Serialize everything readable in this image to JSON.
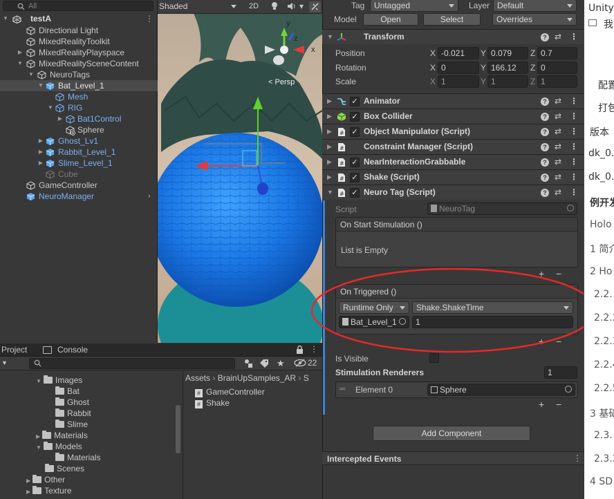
{
  "hierarchy": {
    "search_placeholder": "All",
    "scene_name": "testA",
    "items": [
      {
        "label": "Directional Light"
      },
      {
        "label": "MixedRealityToolkit"
      },
      {
        "label": "MixedRealityPlayspace"
      },
      {
        "label": "MixedRealitySceneContent"
      },
      {
        "label": "NeuroTags"
      },
      {
        "label": "Bat_Level_1"
      },
      {
        "label": "Mesh"
      },
      {
        "label": "RIG"
      },
      {
        "label": "Bat1Control"
      },
      {
        "label": "Sphere"
      },
      {
        "label": "Ghost_Lv1"
      },
      {
        "label": "Rabbit_Level_1"
      },
      {
        "label": "Slime_Level_1"
      },
      {
        "label": "Cube"
      },
      {
        "label": "GameController"
      },
      {
        "label": "NeuroManager"
      }
    ]
  },
  "scene": {
    "shading_mode": "Shaded",
    "mode_2d": "2D",
    "gizmo_y": "y",
    "gizmo_z": "z",
    "gizmo_x": "x",
    "projection": "Persp"
  },
  "project": {
    "tab_project": "Project",
    "tab_console": "Console",
    "hidden_count": "22",
    "folders": [
      {
        "label": "Images"
      },
      {
        "label": "Bat"
      },
      {
        "label": "Ghost"
      },
      {
        "label": "Rabbit"
      },
      {
        "label": "Slime"
      },
      {
        "label": "Materials"
      },
      {
        "label": "Models"
      },
      {
        "label": "Materials"
      },
      {
        "label": "Scenes"
      },
      {
        "label": "Other"
      },
      {
        "label": "Texture"
      }
    ],
    "breadcrumb": [
      "Assets",
      "BrainUpSamples_AR",
      "S"
    ],
    "breadcrumb_sep": "›",
    "assets": [
      {
        "label": "GameController"
      },
      {
        "label": "Shake"
      }
    ]
  },
  "inspector": {
    "tag_label": "Tag",
    "tag_value": "Untagged",
    "layer_label": "Layer",
    "layer_value": "Default",
    "model_label": "Model",
    "open_button": "Open",
    "select_button": "Select",
    "overrides_value": "Overrides",
    "transform": {
      "title": "Transform",
      "position_label": "Position",
      "rotation_label": "Rotation",
      "scale_label": "Scale",
      "axis_x": "X",
      "axis_y": "Y",
      "axis_z": "Z",
      "position": {
        "x": "-0.021",
        "y": "0.079",
        "z": "0.7"
      },
      "rotation": {
        "x": "0",
        "y": "166.12",
        "z": "0"
      },
      "scale": {
        "x": "1",
        "y": "1",
        "z": "1"
      }
    },
    "components": [
      {
        "name": "Animator",
        "checked": true
      },
      {
        "name": "Box Collider",
        "checked": true
      },
      {
        "name": "Object Manipulator (Script)",
        "checked": true
      },
      {
        "name": "Constraint Manager (Script)",
        "checked": false
      },
      {
        "name": "NearInteractionGrabbable",
        "checked": true
      },
      {
        "name": "Shake (Script)",
        "checked": true
      },
      {
        "name": "Neuro Tag (Script)",
        "checked": true
      }
    ],
    "neuro_tag": {
      "script_label": "Script",
      "script_value": "NeuroTag",
      "on_start_title": "On Start Stimulation ()",
      "list_empty": "List is Empty",
      "on_triggered_title": "On Triggered ()",
      "runtime_value": "Runtime Only",
      "function_value": "Shake.ShakeTime",
      "object_value": "Bat_Level_1",
      "argument_value": "1",
      "is_visible_label": "Is Visible",
      "renderers_label": "Stimulation Renderers",
      "renderers_count": "1",
      "element0_label": "Element 0",
      "element0_value": "Sphere"
    },
    "add_component": "Add Component",
    "intercepted_events": "Intercepted Events",
    "plus": "+",
    "minus": "−",
    "help": "?"
  },
  "doc_fragment": {
    "lines": [
      {
        "text": "Unity"
      },
      {
        "text": "我"
      },
      {
        "text": "配置"
      },
      {
        "text": "打包"
      },
      {
        "text": "版本"
      },
      {
        "text": "dk_0."
      },
      {
        "text": "dk_0."
      },
      {
        "text": "例开发"
      },
      {
        "text": "Holo"
      },
      {
        "text": "1 简介"
      },
      {
        "text": "2 Ho"
      },
      {
        "text": "2.2."
      },
      {
        "text": "2.2.2"
      },
      {
        "text": "2.2.3"
      },
      {
        "text": "2.2.4"
      },
      {
        "text": "2.2.5"
      },
      {
        "text": "3 基础"
      },
      {
        "text": "2.3."
      },
      {
        "text": "2.3.2"
      },
      {
        "text": "4 SD"
      }
    ]
  },
  "colors": {
    "annotation_red": "#e8282a",
    "sphere_blue": "#1f7fe6",
    "link_blue": "#7bb1f2"
  }
}
